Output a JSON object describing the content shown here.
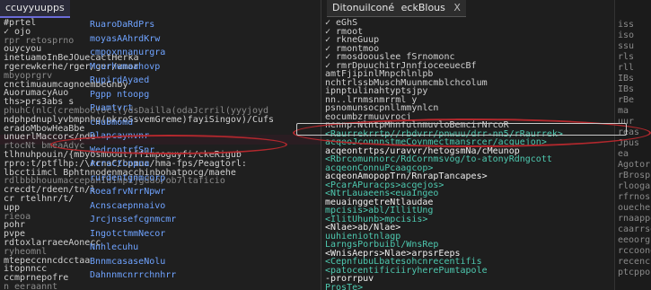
{
  "left_tab": {
    "title": "ccuyyuupps"
  },
  "right_tab": {
    "title": "Ditonuilconé",
    "subtitle": "eckBlous",
    "close": "X"
  },
  "left_lines": [
    "#prtel",
    "  ✓ ojo",
    "rpr retosprno",
    "  ouycyou",
    "  inetuamoInBeJOuecactHerka",
    "rgerewkerhe/rger/ger/amor",
    "  mbyoprgrv",
    "cnctimuaumcagnoembeGnby",
    "AuorumacyAuo",
    "ths>prs3abs s",
    "phuhC(nlC(cremboo(ocl(ydsDailla(odaJcrril(yyyjoyd",
    "ndphpdnuplyvbmpnhg(pkroSsvemGreme)fayiSingov)/Cufs",
    "eradoMbowHeaBbe",
    "unuerlMaccor</pde",
    "rtocNt bmeaAdyc",
    "tlhnuhpouin/{mbyosmoodt)ffimpoguyfi/ckeRigub",
    "rpro:t/ptflhp:/\\rrnaC/bpmuc/hma-fps/Peagtorl:",
    "lbcctiimcl Bphtnnodenmacchinbohatpocg/maehe",
    "rdlbbbhouumaccepanIdimpijgdao/ob7ltaficio",
    "  crecdt/rdeen/tn/l",
    "  cr rtelhnr/t/",
    "  upp",
    "  rieoa",
    "  pohr",
    "  pvpe",
    "rdtoxlarraeeAonecc",
    "  ryheomnl",
    "  mtepeccnncdcctaa",
    "  itopnncc",
    "  ccmprnepofre",
    "  n eeraannt"
  ],
  "left_blue": [
    "RuaroDaRdPrs",
    "moyasAAhrdKrw",
    "cmpoxnnanurgra",
    "Mcurhwmaahovp",
    "RupirdAyaed",
    "Pgpp ntoopg",
    "Puamtvrt",
    "cnubmomd",
    "Dlapcaynvnr",
    "WedrontrfSnr",
    "Acrsctcnpna",
    "rurdentgnmcorp",
    "RoeafrvNrrNpwr",
    "Acnscaepnnaivo",
    "Jrcjnssefcgnmcmr",
    "IngotctmmNecor",
    "Nnhlecuhu",
    "BnnmcasaseNolu",
    "Dahnnmcnrrchnhrr"
  ],
  "right_lines": [
    "  ✓ eGhS",
    "  ✓ rmoot",
    "  ✓ rkneGuup",
    "  ✓ rmontmoo",
    "  ✓ rmosdoouslee fSrnomonc",
    "  ✓ rmrDpuuchitrJnnfioceeuecBf",
    "     amtFjipinlMnpchlnlpb",
    "     nchtrlssbMuschMuunmcmblchcolum",
    "     ipnptulinahtyptsjpy",
    "     nn..lrnmsnmrrml y",
    "     psnomunsocpnllmmynlcn",
    "     eocumbzrmuuvrocj",
    "     nennp.NlntpMhnfulnmuvloBemcirNrcoR",
    "  <Raurrekrrtp//rbdvrr/pnwuu/drr-nn5/rRaurrek>",
    "  acqeoJconnnstmeCoynmectmansrcer/acquejon>",
    "  acqeontrtps/uravvr/hetogsmNa/cMeunop",
    "    <Rbrcomunnorc/RdCornmsvog/to-atonyRdngcott",
    "      acqeonConnuPcaagcop>",
    "      acqeonAmopopTrn/RnrapTancapes>",
    "      <PcarAPuracps>acqejos>",
    "      <NtrLauaeens<euaIngeo",
    "      meuainggetreNtlaudae",
    "      mpcisis>abl/IllitUng",
    "      <IlitUhunb>mpcisis>",
    "        <Nlae>ab/Nlae>",
    "        uuhieniotnlagp",
    "        LarngsPorbuibl/WnsRep",
    "      <WnisAeprs>Nlae>arpsrEeps",
    "      <CepnfubuLbatesohcnrecentifis",
    "      <patocentificiiryherePumtapole",
    "    -prorrpuv",
    "    ProsTe>"
  ],
  "far_right": [
    "iss",
    "iso",
    "ssu",
    "rls",
    "rll",
    "IBs",
    "IBs",
    "rBe",
    "ma",
    "uur",
    "reas",
    "Jpus",
    "ea",
    "Agotoruc",
    "rBrosps",
    "rloogarsncs",
    "rfrnosirrop",
    "ouecheuclel",
    "rnaapponcs",
    "caarrsgucv",
    "eeoorgcpvrl",
    "rccoonenrne",
    "recencchnnre",
    "ptcpporl"
  ]
}
